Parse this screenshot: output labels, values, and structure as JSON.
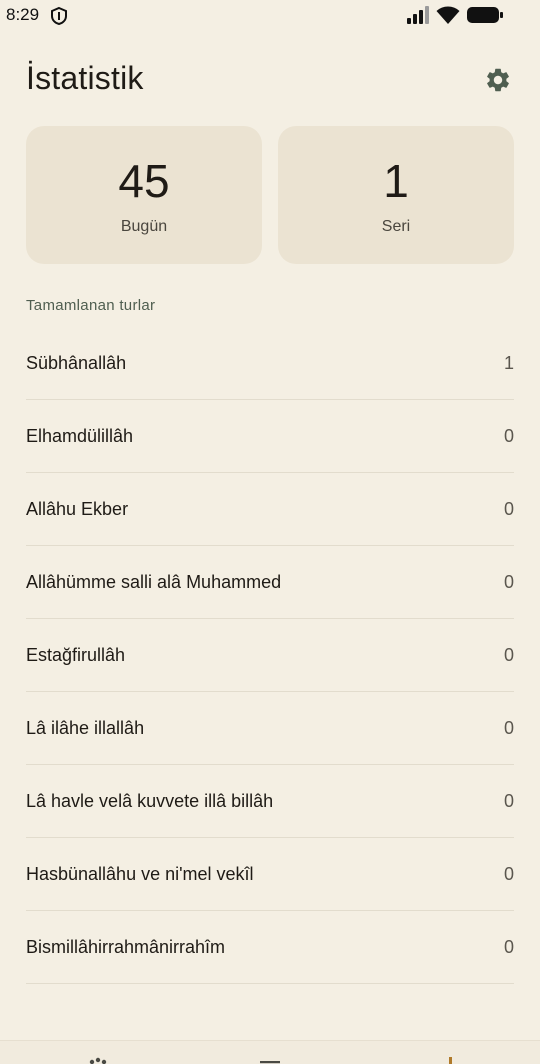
{
  "status_bar": {
    "time": "8:29",
    "icons": [
      "shield-icon",
      "signal-icon",
      "wifi-icon",
      "battery-icon"
    ]
  },
  "header": {
    "title": "İstatistik",
    "settings_icon": "gear-icon"
  },
  "stats": {
    "today_value": "45",
    "today_label": "Bugün",
    "streak_value": "1",
    "streak_label": "Seri"
  },
  "completed": {
    "section_title": "Tamamlanan turlar",
    "items": [
      {
        "label": "Sübhânallâh",
        "count": "1"
      },
      {
        "label": "Elhamdülillâh",
        "count": "0"
      },
      {
        "label": "Allâhu Ekber",
        "count": "0"
      },
      {
        "label": "Allâhümme salli alâ Muhammed",
        "count": "0"
      },
      {
        "label": "Estağfirullâh",
        "count": "0"
      },
      {
        "label": "Lâ ilâhe illallâh",
        "count": "0"
      },
      {
        "label": "Lâ havle velâ kuvvete illâ billâh",
        "count": "0"
      },
      {
        "label": "Hasbünallâhu ve ni'mel vekîl",
        "count": "0"
      },
      {
        "label": "Bismillâhirrahmânirrahîm",
        "count": "0"
      }
    ]
  },
  "bottom_nav": {
    "icons": [
      "beads-icon",
      "list-icon",
      "stats-icon"
    ]
  },
  "colors": {
    "background": "#f4efe3",
    "card": "#ebe3d2",
    "accent": "#4f5e50",
    "stats_accent": "#b07a2a"
  }
}
